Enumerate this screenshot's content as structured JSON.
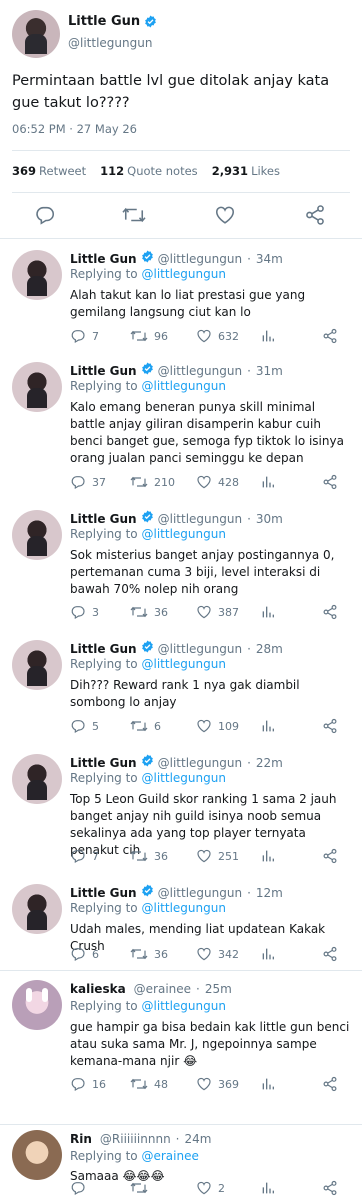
{
  "main_tweet": {
    "author_name": "Little Gun",
    "author_handle": "@littlegungun",
    "text": "Permintaan battle lvl gue ditolak anjay kata gue takut lo????",
    "timestamp": "06:52 PM · 27 May 26",
    "stats": {
      "retweets_count": "369",
      "retweets_label": "Retweet",
      "quotes_count": "112",
      "quotes_label": "Quote notes",
      "likes_count": "2,931",
      "likes_label": "Likes"
    }
  },
  "replies": [
    {
      "name": "Little Gun",
      "handle": "@littlegungun",
      "time": "34m",
      "replying_label": "Replying to",
      "replying_to": "@littlegungun",
      "text": "Alah takut kan lo liat prestasi gue yang gemilang langsung ciut kan lo",
      "reply_count": "7",
      "retweet_count": "96",
      "like_count": "632"
    },
    {
      "name": "Little Gun",
      "handle": "@littlegungun",
      "time": "31m",
      "replying_label": "Replying to",
      "replying_to": "@littlegungun",
      "text": "Kalo emang beneran punya skill minimal battle anjay giliran disamperin kabur cuih benci banget gue, semoga fyp tiktok lo isinya orang jualan panci seminggu ke depan",
      "reply_count": "37",
      "retweet_count": "210",
      "like_count": "428"
    },
    {
      "name": "Little Gun",
      "handle": "@littlegungun",
      "time": "30m",
      "replying_label": "Replying to",
      "replying_to": "@littlegungun",
      "text": "Sok misterius banget anjay postingannya 0, pertemanan cuma 3 biji, level interaksi di bawah 70% nolep nih orang",
      "reply_count": "3",
      "retweet_count": "36",
      "like_count": "387"
    },
    {
      "name": "Little Gun",
      "handle": "@littlegungun",
      "time": "28m",
      "replying_label": "Replying to",
      "replying_to": "@littlegungun",
      "text": "Dih??? Reward rank 1 nya gak diambil sombong lo anjay",
      "reply_count": "5",
      "retweet_count": "6",
      "like_count": "109"
    },
    {
      "name": "Little Gun",
      "handle": "@littlegungun",
      "time": "22m",
      "replying_label": "Replying to",
      "replying_to": "@littlegungun",
      "text": "Top 5 Leon Guild skor ranking 1 sama 2 jauh banget anjay nih guild isinya noob semua sekalinya ada yang top player ternyata penakut cih",
      "reply_count": "7",
      "retweet_count": "36",
      "like_count": "251"
    },
    {
      "name": "Little Gun",
      "handle": "@littlegungun",
      "time": "12m",
      "replying_label": "Replying to",
      "replying_to": "@littlegungun",
      "text": "Udah males, mending liat updatean Kakak Crush",
      "reply_count": "6",
      "retweet_count": "36",
      "like_count": "342"
    },
    {
      "name": "kalieska",
      "handle": "@erainee",
      "time": "25m",
      "replying_label": "Replying to",
      "replying_to": "@littlegungun",
      "text": "gue hampir ga bisa bedain kak little gun benci atau suka sama Mr. J, ngepoinnya sampe kemana-mana njir 😂",
      "reply_count": "16",
      "retweet_count": "48",
      "like_count": "369"
    },
    {
      "name": "Rin",
      "handle": "@Riiiiiinnnn",
      "time": "24m",
      "replying_label": "Replying to",
      "replying_to": "@erainee",
      "text": "Samaaa 😂😂😂",
      "reply_count": "",
      "retweet_count": "",
      "like_count": "2"
    }
  ],
  "colors": {
    "accent": "#1da1f2",
    "muted": "#657786",
    "text": "#14171a",
    "divider": "#e1e8ed"
  },
  "icons": [
    "verified-badge-icon",
    "reply-icon",
    "retweet-icon",
    "like-icon",
    "analytics-icon",
    "share-icon"
  ]
}
